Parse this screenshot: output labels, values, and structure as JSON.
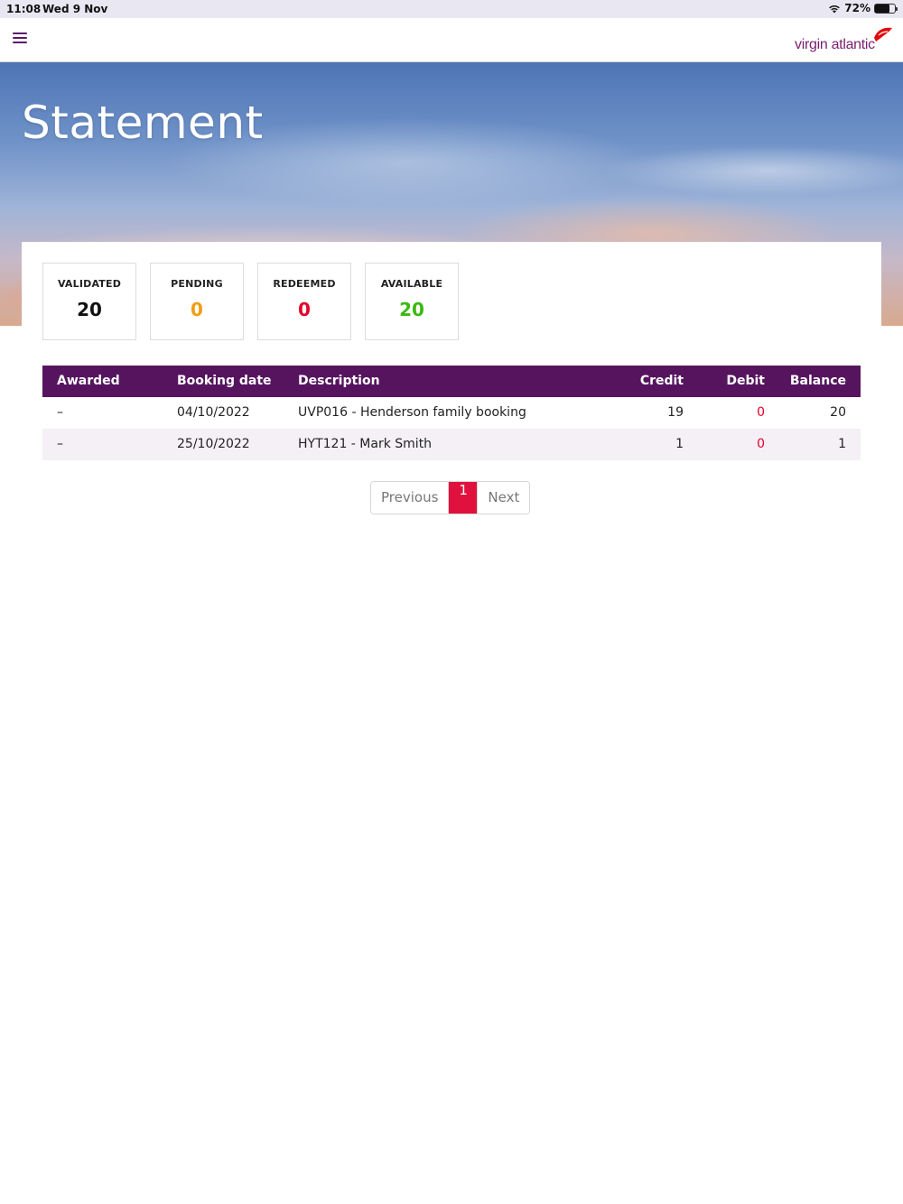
{
  "status_bar": {
    "time": "11:08",
    "date": "Wed 9 Nov",
    "battery_percent": "72%",
    "battery_level": 0.72
  },
  "header": {
    "menu_icon": "hamburger-menu-icon",
    "logo_text": "virgin atlantic",
    "brand_color": "#7a1f6f"
  },
  "hero": {
    "title": "Statement"
  },
  "stats": [
    {
      "label": "VALIDATED",
      "value": "20",
      "color": "#111111"
    },
    {
      "label": "PENDING",
      "value": "0",
      "color": "#f39c12"
    },
    {
      "label": "REDEEMED",
      "value": "0",
      "color": "#e4002b"
    },
    {
      "label": "AVAILABLE",
      "value": "20",
      "color": "#3ab90f"
    }
  ],
  "table": {
    "headers": {
      "awarded": "Awarded",
      "booking_date": "Booking date",
      "description": "Description",
      "credit": "Credit",
      "debit": "Debit",
      "balance": "Balance"
    },
    "rows": [
      {
        "awarded": "–",
        "booking_date": "04/10/2022",
        "description": "UVP016 - Henderson family booking",
        "credit": "19",
        "debit": "0",
        "balance": "20"
      },
      {
        "awarded": "–",
        "booking_date": "25/10/2022",
        "description": "HYT121 - Mark Smith",
        "credit": "1",
        "debit": "0",
        "balance": "1"
      }
    ]
  },
  "pagination": {
    "previous": "Previous",
    "current_page": "1",
    "next": "Next",
    "active_color": "#e0123d"
  }
}
